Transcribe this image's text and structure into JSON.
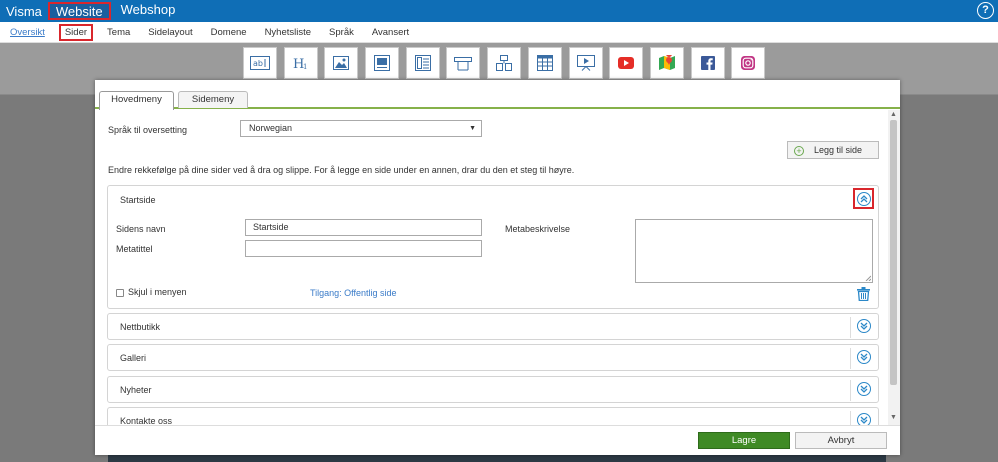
{
  "topbar": {
    "brand": "Visma",
    "nav": [
      {
        "label": "Website",
        "active": true
      },
      {
        "label": "Webshop",
        "active": false
      }
    ],
    "help_label": "?"
  },
  "subnav": {
    "items": [
      {
        "label": "Oversikt",
        "state": "link"
      },
      {
        "label": "Sider",
        "state": "active"
      },
      {
        "label": "Tema",
        "state": ""
      },
      {
        "label": "Sidelayout",
        "state": ""
      },
      {
        "label": "Domene",
        "state": ""
      },
      {
        "label": "Nyhetsliste",
        "state": ""
      },
      {
        "label": "Språk",
        "state": ""
      },
      {
        "label": "Avansert",
        "state": ""
      }
    ]
  },
  "toolbar": {
    "tools": [
      "text-tool-icon",
      "heading-tool-icon",
      "image-tool-icon",
      "image-text-tool-icon",
      "text-column-tool-icon",
      "box-tool-icon",
      "layout-tool-icon",
      "table-tool-icon",
      "slideshow-tool-icon",
      "youtube-icon",
      "maps-icon",
      "facebook-icon",
      "instagram-icon"
    ],
    "colors": {
      "youtube": "#e52d27",
      "facebook": "#3b5998",
      "instagram": "#c13584",
      "maps": "#34a853"
    }
  },
  "dialog": {
    "tabs": [
      {
        "label": "Hovedmeny",
        "active": true
      },
      {
        "label": "Sidemeny",
        "active": false
      }
    ],
    "language_label": "Språk til oversetting",
    "language_value": "Norwegian",
    "add_page_label": "Legg til side",
    "instructions": "Endre rekkefølge på dine sider ved å dra og slippe. For å legge en side under en annen, drar du den et steg til høyre.",
    "expanded_page": {
      "title": "Startside",
      "name_label": "Sidens navn",
      "name_value": "Startside",
      "metatitle_label": "Metatittel",
      "metatitle_value": "",
      "metadesc_label": "Metabeskrivelse",
      "hide_label": "Skjul i menyen",
      "access_label": "Tilgang: Offentlig side"
    },
    "collapsed_pages": [
      {
        "title": "Nettbutikk"
      },
      {
        "title": "Galleri"
      },
      {
        "title": "Nyheter"
      },
      {
        "title": "Kontakte oss"
      }
    ],
    "save_label": "Lagre",
    "cancel_label": "Avbryt"
  },
  "colors": {
    "topbar": "#0f6eb6",
    "accent_green": "#3f8a25",
    "highlight_red": "#d9262c",
    "link_blue": "#3a7bc8"
  }
}
